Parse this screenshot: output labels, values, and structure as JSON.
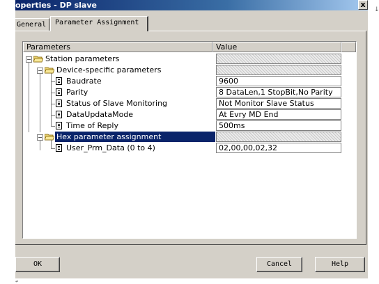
{
  "window": {
    "title": "operties - DP slave",
    "close_glyph": "x"
  },
  "tabs": [
    {
      "label": "General",
      "active": false
    },
    {
      "label": "Parameter Assignment",
      "active": true
    }
  ],
  "grid": {
    "columns": [
      "Parameters",
      "Value"
    ],
    "rows": [
      {
        "label": "Station parameters",
        "value": "",
        "kind": "folder",
        "expanded": true
      },
      {
        "label": "Device-specific parameters",
        "value": "",
        "kind": "folder",
        "expanded": true
      },
      {
        "label": "Baudrate",
        "value": "9600",
        "kind": "param"
      },
      {
        "label": "Parity",
        "value": "8 DataLen,1 StopBit,No Parity",
        "kind": "param"
      },
      {
        "label": "Status of Slave Monitoring",
        "value": "Not Monitor Slave Status",
        "kind": "param"
      },
      {
        "label": "DataUpdataMode",
        "value": "At Evry MD End",
        "kind": "param"
      },
      {
        "label": "Time of Reply",
        "value": "500ms",
        "kind": "param"
      },
      {
        "label": "Hex parameter assignment",
        "value": "",
        "kind": "folder",
        "expanded": true,
        "selected": true
      },
      {
        "label": "User_Prm_Data (0 to 4)",
        "value": "02,00,00,02,32",
        "kind": "param"
      }
    ]
  },
  "buttons": {
    "ok": "OK",
    "cancel": "Cancel",
    "help": "Help"
  },
  "colors": {
    "selection": "#0a246a",
    "face": "#d4d0c8"
  }
}
